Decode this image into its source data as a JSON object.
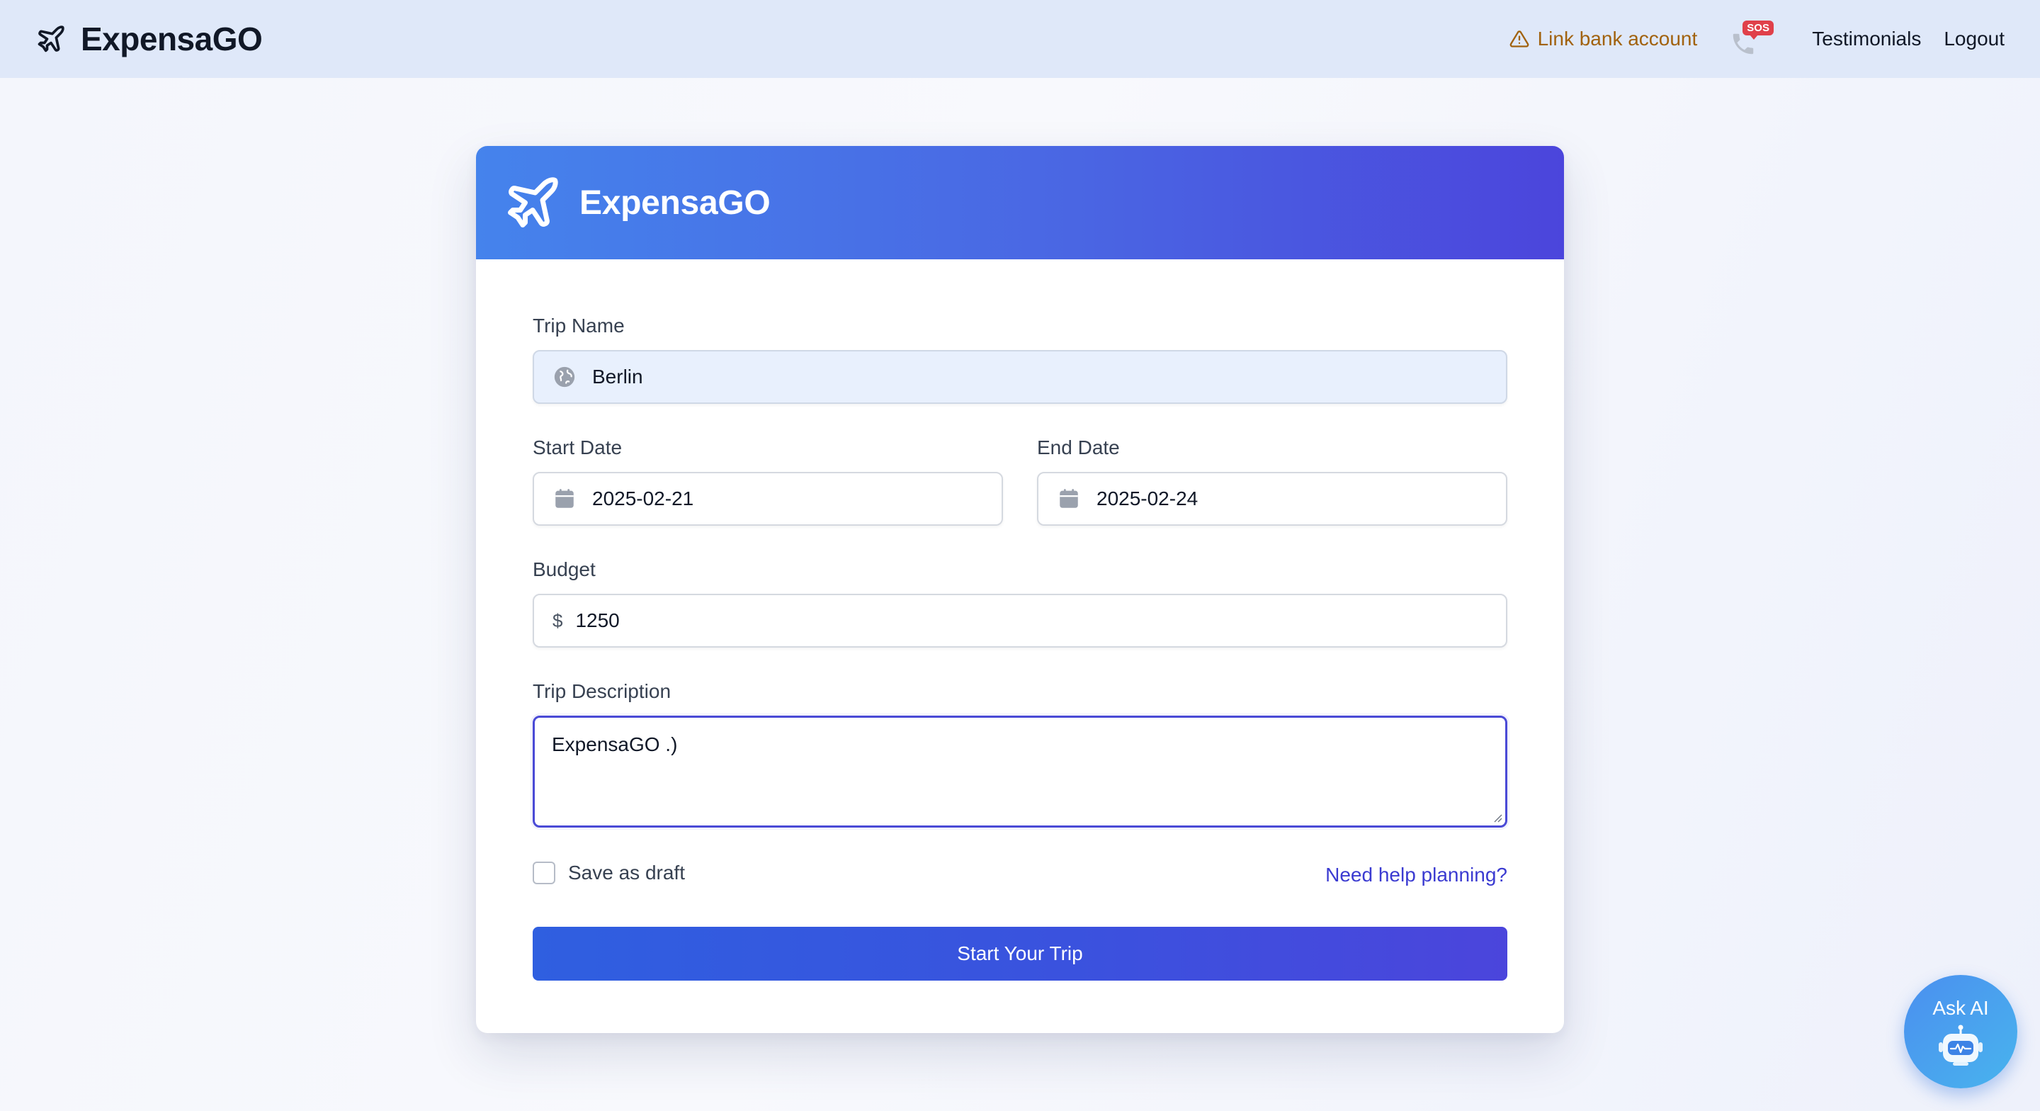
{
  "navbar": {
    "brand": "ExpensaGO",
    "link_bank": "Link bank account",
    "sos_badge": "SOS",
    "testimonials": "Testimonials",
    "logout": "Logout"
  },
  "card": {
    "title": "ExpensaGO"
  },
  "form": {
    "trip_name": {
      "label": "Trip Name",
      "value": "Berlin",
      "icon": "globe-icon"
    },
    "start_date": {
      "label": "Start Date",
      "value": "2025-02-21",
      "icon": "calendar-icon"
    },
    "end_date": {
      "label": "End Date",
      "value": "2025-02-24",
      "icon": "calendar-icon"
    },
    "budget": {
      "label": "Budget",
      "currency": "$",
      "value": "1250"
    },
    "description": {
      "label": "Trip Description",
      "value": "ExpensaGO .)"
    },
    "save_draft": {
      "label": "Save as draft",
      "checked": false
    },
    "help_link": "Need help planning?",
    "submit": "Start Your Trip"
  },
  "ask_ai": {
    "label": "Ask AI",
    "icon": "robot-icon"
  },
  "colors": {
    "navbar_bg": "#dfe8f9",
    "header_gradient_start": "#4583ec",
    "header_gradient_end": "#4b45dc",
    "accent": "#3b3bd1",
    "warning": "#a1620e",
    "sos": "#e0404a"
  }
}
